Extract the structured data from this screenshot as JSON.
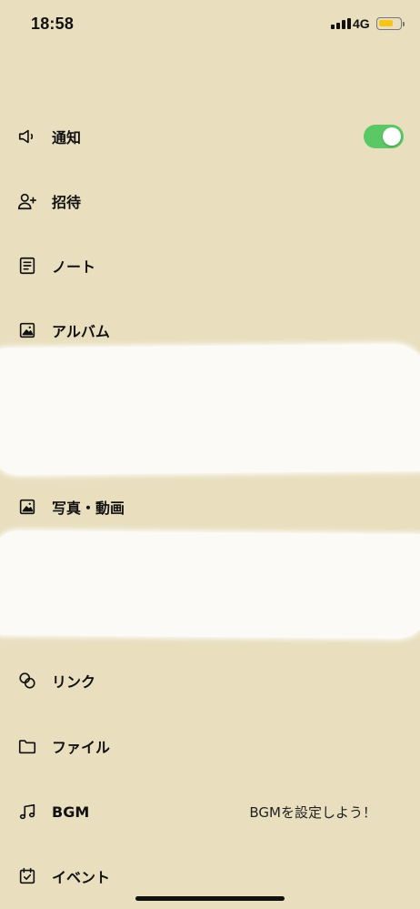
{
  "status_bar": {
    "time": "18:58",
    "network": "4G",
    "battery_level": 0.6,
    "battery_color": "#f5c518"
  },
  "theme": {
    "background": "#e9dfbf",
    "toggle_on_color": "#5ac864"
  },
  "menu": {
    "items": [
      {
        "key": "notification",
        "label": "通知",
        "icon": "speaker-icon",
        "toggle": true
      },
      {
        "key": "invite",
        "label": "招待",
        "icon": "user-plus-icon"
      },
      {
        "key": "note",
        "label": "ノート",
        "icon": "note-icon"
      },
      {
        "key": "album",
        "label": "アルバム",
        "icon": "album-icon"
      },
      {
        "key": "photos",
        "label": "写真・動画",
        "icon": "photo-icon"
      },
      {
        "key": "link",
        "label": "リンク",
        "icon": "link-icon"
      },
      {
        "key": "file",
        "label": "ファイル",
        "icon": "folder-icon"
      },
      {
        "key": "bgm",
        "label": "BGM",
        "icon": "music-note-icon",
        "side_text": "BGMを設定しよう！"
      },
      {
        "key": "event",
        "label": "イベント",
        "icon": "calendar-icon"
      }
    ]
  }
}
